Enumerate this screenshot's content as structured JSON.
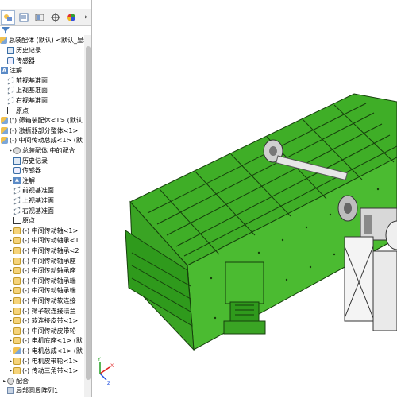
{
  "tree": {
    "root_label": "总装配体 (默认) <默认_显示",
    "items": [
      {
        "label": "历史记录",
        "icon": "history-icon"
      },
      {
        "label": "传感器",
        "icon": "sensor-icon"
      },
      {
        "label": "注解",
        "icon": "annotation-icon"
      },
      {
        "label": "前视基准面",
        "icon": "plane-icon"
      },
      {
        "label": "上视基准面",
        "icon": "plane-icon"
      },
      {
        "label": "右视基准面",
        "icon": "plane-icon"
      },
      {
        "label": "原点",
        "icon": "origin-icon"
      },
      {
        "label": "(f) 筛箱装配体<1> (默认",
        "icon": "assembly-icon"
      },
      {
        "label": "(-) 激振器部分整体<1>",
        "icon": "assembly-icon"
      },
      {
        "label": "(-) 中间传动总成<1> (默",
        "icon": "assembly-icon"
      },
      {
        "label": "总装配体 中的配合",
        "icon": "mate-icon"
      },
      {
        "label": "历史记录",
        "icon": "history-icon"
      },
      {
        "label": "传感器",
        "icon": "sensor-icon"
      },
      {
        "label": "注解",
        "icon": "annotation-icon"
      },
      {
        "label": "前视基准面",
        "icon": "plane-icon"
      },
      {
        "label": "上视基准面",
        "icon": "plane-icon"
      },
      {
        "label": "右视基准面",
        "icon": "plane-icon"
      },
      {
        "label": "原点",
        "icon": "origin-icon"
      },
      {
        "label": "(-) 中间传动轴<1>",
        "icon": "part-icon"
      },
      {
        "label": "(-) 中间传动轴承<1",
        "icon": "part-icon"
      },
      {
        "label": "(-) 中间传动轴承<2",
        "icon": "part-icon"
      },
      {
        "label": "(-) 中间传动轴承座",
        "icon": "part-icon"
      },
      {
        "label": "(-) 中间传动轴承座",
        "icon": "part-icon"
      },
      {
        "label": "(-) 中间传动轴承端",
        "icon": "part-icon"
      },
      {
        "label": "(-) 中间传动轴承端",
        "icon": "part-icon"
      },
      {
        "label": "(-) 中间传动软连接",
        "icon": "part-icon"
      },
      {
        "label": "(-) 筛子软连接法兰",
        "icon": "part-icon"
      },
      {
        "label": "(-) 软连接皮带<1>",
        "icon": "part-icon"
      },
      {
        "label": "(-) 中间传动皮带轮",
        "icon": "part-icon"
      },
      {
        "label": "(-) 电机底座<1> (默",
        "icon": "part-icon"
      },
      {
        "label": "(-) 电机总成<1> (默",
        "icon": "assembly-icon"
      },
      {
        "label": "(-) 电机皮带轮<1>",
        "icon": "part-icon"
      },
      {
        "label": "(-) 传动三角带<1>",
        "icon": "part-icon"
      },
      {
        "label": "配合",
        "icon": "mate-icon"
      },
      {
        "label": "局部圆周阵列1",
        "icon": "pattern-icon"
      }
    ]
  },
  "colors": {
    "model_green": "#43b02a",
    "model_dark": "#1d5a12",
    "motor_gray": "#c9c9c9",
    "axis_x": "#e02020",
    "axis_y": "#20a020",
    "axis_z": "#2050e0"
  },
  "triad": {
    "x_label": "X",
    "y_label": "Y",
    "z_label": "Z"
  }
}
